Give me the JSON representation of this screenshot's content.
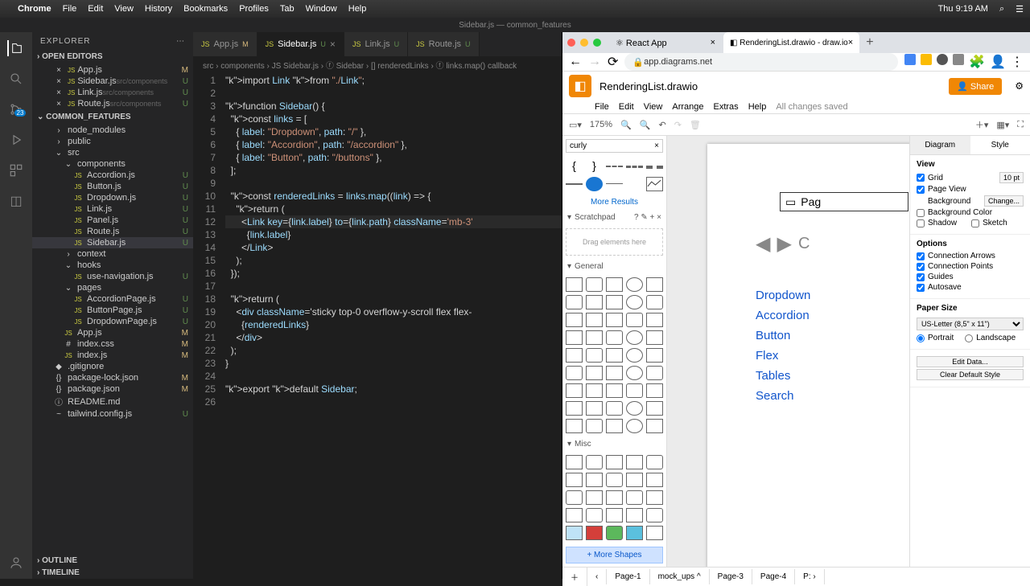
{
  "mac_menu": {
    "app": "Chrome",
    "items": [
      "File",
      "Edit",
      "View",
      "History",
      "Bookmarks",
      "Profiles",
      "Tab",
      "Window",
      "Help"
    ],
    "clock": "Thu 9:19 AM"
  },
  "title_bar": "Sidebar.js — common_features",
  "explorer": {
    "title": "EXPLORER",
    "open_editors": "OPEN EDITORS",
    "open": [
      {
        "name": "App.js",
        "badge": "M"
      },
      {
        "name": "Sidebar.js",
        "hint": "src/components",
        "badge": "U"
      },
      {
        "name": "Link.js",
        "hint": "src/components",
        "badge": "U"
      },
      {
        "name": "Route.js",
        "hint": "src/components",
        "badge": "U"
      }
    ],
    "project": "COMMON_FEATURES",
    "tree": [
      {
        "l": 1,
        "icon": "›",
        "name": "node_modules"
      },
      {
        "l": 1,
        "icon": "›",
        "name": "public"
      },
      {
        "l": 1,
        "icon": "⌄",
        "name": "src",
        "badge": ""
      },
      {
        "l": 2,
        "icon": "⌄",
        "name": "components",
        "badge": ""
      },
      {
        "l": 3,
        "icon": "JS",
        "name": "Accordion.js",
        "badge": "U"
      },
      {
        "l": 3,
        "icon": "JS",
        "name": "Button.js",
        "badge": "U"
      },
      {
        "l": 3,
        "icon": "JS",
        "name": "Dropdown.js",
        "badge": "U"
      },
      {
        "l": 3,
        "icon": "JS",
        "name": "Link.js",
        "badge": "U"
      },
      {
        "l": 3,
        "icon": "JS",
        "name": "Panel.js",
        "badge": "U"
      },
      {
        "l": 3,
        "icon": "JS",
        "name": "Route.js",
        "badge": "U"
      },
      {
        "l": 3,
        "icon": "JS",
        "name": "Sidebar.js",
        "badge": "U",
        "sel": true
      },
      {
        "l": 2,
        "icon": "›",
        "name": "context",
        "badge": ""
      },
      {
        "l": 2,
        "icon": "⌄",
        "name": "hooks",
        "badge": ""
      },
      {
        "l": 3,
        "icon": "JS",
        "name": "use-navigation.js",
        "badge": "U"
      },
      {
        "l": 2,
        "icon": "⌄",
        "name": "pages",
        "badge": ""
      },
      {
        "l": 3,
        "icon": "JS",
        "name": "AccordionPage.js",
        "badge": "U"
      },
      {
        "l": 3,
        "icon": "JS",
        "name": "ButtonPage.js",
        "badge": "U"
      },
      {
        "l": 3,
        "icon": "JS",
        "name": "DropdownPage.js",
        "badge": "U"
      },
      {
        "l": 2,
        "icon": "JS",
        "name": "App.js",
        "badge": "M"
      },
      {
        "l": 2,
        "icon": "#",
        "name": "index.css",
        "badge": "M"
      },
      {
        "l": 2,
        "icon": "JS",
        "name": "index.js",
        "badge": "M"
      },
      {
        "l": 1,
        "icon": "◆",
        "name": ".gitignore"
      },
      {
        "l": 1,
        "icon": "{}",
        "name": "package-lock.json",
        "badge": "M"
      },
      {
        "l": 1,
        "icon": "{}",
        "name": "package.json",
        "badge": "M"
      },
      {
        "l": 1,
        "icon": "ⓘ",
        "name": "README.md"
      },
      {
        "l": 1,
        "icon": "~",
        "name": "tailwind.config.js",
        "badge": "U"
      }
    ],
    "outline": "OUTLINE",
    "timeline": "TIMELINE"
  },
  "editor": {
    "tabs": [
      {
        "name": "App.js",
        "badge": "M"
      },
      {
        "name": "Sidebar.js",
        "badge": "U",
        "active": true,
        "close": true
      },
      {
        "name": "Link.js",
        "badge": "U"
      },
      {
        "name": "Route.js",
        "badge": "U"
      }
    ],
    "crumbs": "src › components › JS Sidebar.js › ⓕ Sidebar › [] renderedLinks › ⓕ links.map() callback",
    "lines": [
      "import Link from \"./Link\";",
      "",
      "function Sidebar() {",
      "  const links = [",
      "    { label: \"Dropdown\", path: \"/\" },",
      "    { label: \"Accordion\", path: \"/accordion\" },",
      "    { label: \"Button\", path: \"/buttons\" },",
      "  ];",
      "",
      "  const renderedLinks = links.map((link) => {",
      "    return (",
      "      <Link key={link.label} to={link.path} className='mb-3'",
      "        {link.label}",
      "      </Link>",
      "    );",
      "  });",
      "",
      "  return (",
      "    <div className='sticky top-0 overflow-y-scroll flex flex-",
      "      {renderedLinks}",
      "    </div>",
      "  );",
      "}",
      "",
      "export default Sidebar;",
      ""
    ],
    "current": 12
  },
  "browser": {
    "tabs": [
      {
        "name": "React App"
      },
      {
        "name": "RenderingList.drawio - draw.io",
        "active": true
      }
    ],
    "url": "app.diagrams.net"
  },
  "drawio": {
    "filename": "RenderingList.drawio",
    "menu": [
      "File",
      "Edit",
      "View",
      "Arrange",
      "Extras",
      "Help"
    ],
    "saved": "All changes saved",
    "share": "Share",
    "zoom": "175%",
    "search": "curly",
    "more_results": "More Results",
    "scratchpad": "Scratchpad",
    "scratch_hint": "Drag elements here",
    "general": "General",
    "misc": "Misc",
    "more_shapes": "+ More Shapes",
    "canvas_title": "Pag",
    "sidebar_items": [
      "Dropdown",
      "Accordion",
      "Button",
      "Flex",
      "Tables",
      "Search"
    ],
    "format": {
      "tabs": [
        "Diagram",
        "Style"
      ],
      "view": "View",
      "grid": "Grid",
      "grid_val": "10 pt",
      "page_view": "Page View",
      "background": "Background",
      "change": "Change...",
      "bg_color": "Background Color",
      "shadow": "Shadow",
      "sketch": "Sketch",
      "options": "Options",
      "conn_arrows": "Connection Arrows",
      "conn_points": "Connection Points",
      "guides": "Guides",
      "autosave": "Autosave",
      "paper": "Paper Size",
      "paper_val": "US-Letter (8,5\" x 11\")",
      "portrait": "Portrait",
      "landscape": "Landscape",
      "edit_data": "Edit Data...",
      "clear_style": "Clear Default Style"
    },
    "pages": [
      "Page-1",
      "mock_ups",
      "Page-3",
      "Page-4"
    ]
  }
}
